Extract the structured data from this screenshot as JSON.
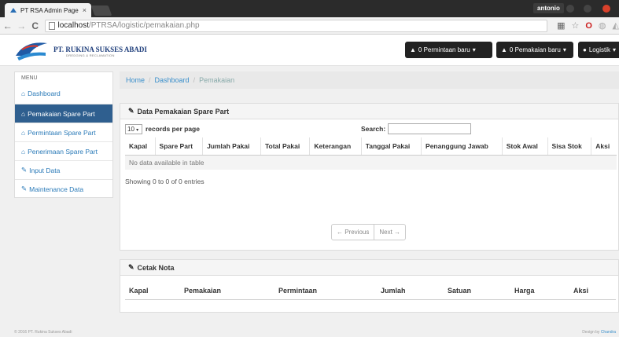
{
  "browser": {
    "tab_title": "PT RSA Admin Page",
    "tab_close": "×",
    "user": "antonio",
    "url_host": "localhost",
    "url_path": "/PTRSA/logistic/pemakaian.php",
    "back": "←",
    "forward": "→",
    "reload": "C"
  },
  "navbar": {
    "brand": "PT. RUKINA SUKSES ABADI",
    "brand_sub": "DREDGING & RECLAMATION",
    "permintaan_label": "0 Permintaan baru",
    "pemakaian_label": "0 Pemakaian baru",
    "user_label": "Logistik",
    "caret": "▾"
  },
  "sidebar": {
    "title": "MENU",
    "items": [
      {
        "label": "Dashboard",
        "icon": "home-icon"
      },
      {
        "label": "Pemakaian Spare Part",
        "icon": "home-icon"
      },
      {
        "label": "Permintaan Spare Part",
        "icon": "home-icon"
      },
      {
        "label": "Penerimaan Spare Part",
        "icon": "home-icon"
      },
      {
        "label": "Input Data",
        "icon": "edit-icon"
      },
      {
        "label": "Maintenance Data",
        "icon": "edit-icon"
      }
    ]
  },
  "breadcrumb": {
    "home": "Home",
    "dashboard": "Dashboard",
    "current": "Pemakaian",
    "sep": "/"
  },
  "data_panel": {
    "title": "Data Pemakaian Spare Part",
    "length_value": "10",
    "records_label": "records per page",
    "search_label": "Search:",
    "columns": [
      "Kapal",
      "Spare Part",
      "Jumlah Pakai",
      "Total Pakai",
      "Keterangan",
      "Tanggal Pakai",
      "Penanggung Jawab",
      "Stok Awal",
      "Sisa Stok",
      "Aksi"
    ],
    "empty_message": "No data available in table",
    "info": "Showing 0 to 0 of 0 entries",
    "prev": "← Previous",
    "next": "Next →"
  },
  "nota_panel": {
    "title": "Cetak Nota",
    "columns": [
      "Kapal",
      "Pemakaian",
      "Permintaan",
      "Jumlah",
      "Satuan",
      "Harga",
      "Aksi"
    ]
  },
  "footer": {
    "left": "© 2016 PT. Rukina Sukses Abadi",
    "right_prefix": "Design by",
    "right_link": "Chandra"
  },
  "colors": {
    "sidebar_active": "#2f5f8f",
    "link": "#3a8fcb",
    "navbar_button": "#222222"
  }
}
